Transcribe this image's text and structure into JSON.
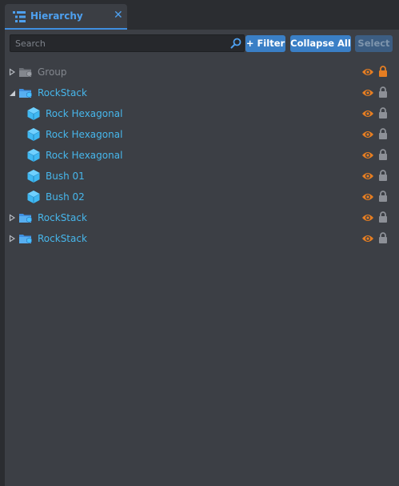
{
  "tab": {
    "title": "Hierarchy",
    "close_glyph": "✕"
  },
  "toolbar": {
    "search_placeholder": "Search",
    "filter_label": "+ Filter",
    "collapse_label": "Collapse All",
    "select_label": "Select"
  },
  "colors": {
    "accent": "#4ea0ef",
    "item_text": "#47b7ec",
    "muted_text": "#83878e",
    "eye_active": "#e67e22",
    "lock_locked": "#e67e22",
    "lock_unlocked": "#8d9097"
  },
  "tree": [
    {
      "label": "Group",
      "kind": "folder",
      "expander": "collapsed",
      "dim": true,
      "visible": true,
      "locked": true
    },
    {
      "label": "RockStack",
      "kind": "folder",
      "expander": "expanded",
      "dim": false,
      "visible": true,
      "locked": false
    },
    {
      "label": "Rock Hexagonal",
      "kind": "object",
      "expander": "none",
      "dim": false,
      "visible": true,
      "locked": false
    },
    {
      "label": "Rock Hexagonal",
      "kind": "object",
      "expander": "none",
      "dim": false,
      "visible": true,
      "locked": false
    },
    {
      "label": "Rock Hexagonal",
      "kind": "object",
      "expander": "none",
      "dim": false,
      "visible": true,
      "locked": false
    },
    {
      "label": "Bush 01",
      "kind": "object",
      "expander": "none",
      "dim": false,
      "visible": true,
      "locked": false
    },
    {
      "label": "Bush 02",
      "kind": "object",
      "expander": "none",
      "dim": false,
      "visible": true,
      "locked": false
    },
    {
      "label": "RockStack",
      "kind": "folder",
      "expander": "collapsed",
      "dim": false,
      "visible": true,
      "locked": false
    },
    {
      "label": "RockStack",
      "kind": "folder",
      "expander": "collapsed",
      "dim": false,
      "visible": true,
      "locked": false
    }
  ]
}
